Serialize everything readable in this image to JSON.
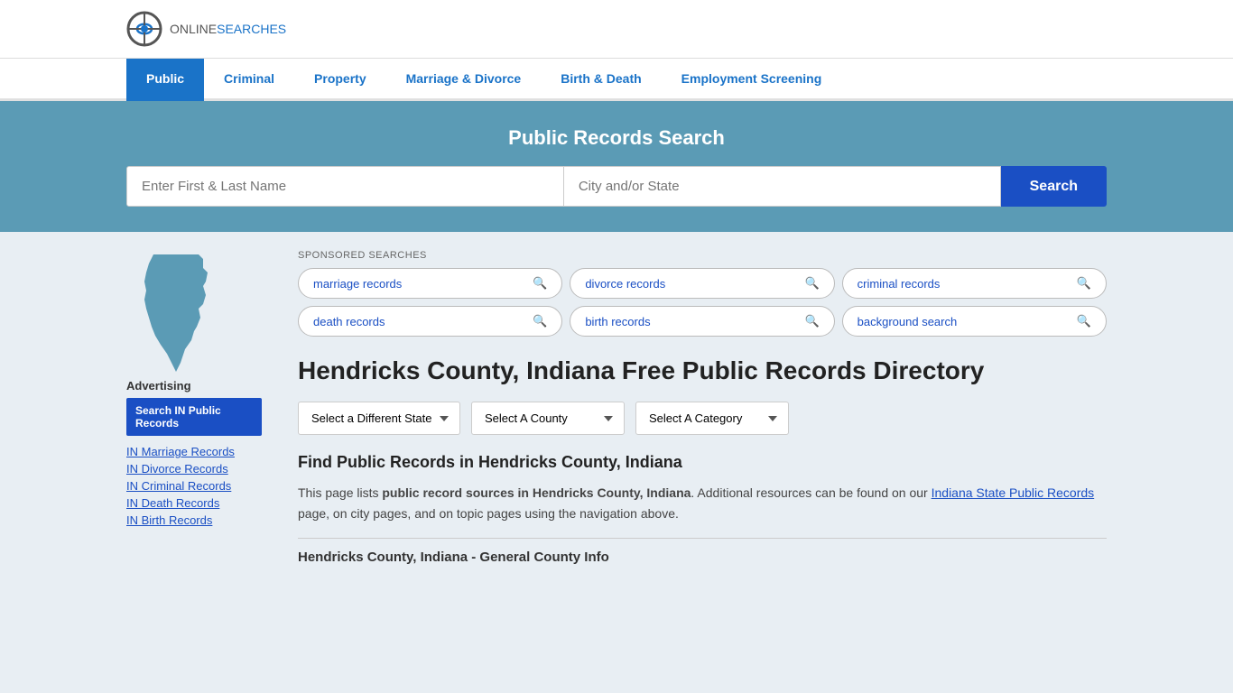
{
  "logo": {
    "online": "ONLINE",
    "searches": "SEARCHES"
  },
  "nav": {
    "items": [
      {
        "label": "Public",
        "active": true
      },
      {
        "label": "Criminal",
        "active": false
      },
      {
        "label": "Property",
        "active": false
      },
      {
        "label": "Marriage & Divorce",
        "active": false
      },
      {
        "label": "Birth & Death",
        "active": false
      },
      {
        "label": "Employment Screening",
        "active": false
      }
    ]
  },
  "hero": {
    "title": "Public Records Search",
    "name_placeholder": "Enter First & Last Name",
    "location_placeholder": "City and/or State",
    "search_button": "Search"
  },
  "sponsored": {
    "label": "SPONSORED SEARCHES",
    "tags": [
      {
        "text": "marriage records"
      },
      {
        "text": "divorce records"
      },
      {
        "text": "criminal records"
      },
      {
        "text": "death records"
      },
      {
        "text": "birth records"
      },
      {
        "text": "background search"
      }
    ]
  },
  "page": {
    "title": "Hendricks County, Indiana Free Public Records Directory",
    "dropdowns": {
      "state": "Select a Different State",
      "county": "Select A County",
      "category": "Select A Category"
    },
    "find_title": "Find Public Records in Hendricks County, Indiana",
    "find_text_1": "This page lists ",
    "find_bold": "public record sources in Hendricks County, Indiana",
    "find_text_2": ". Additional resources can be found on our ",
    "find_link": "Indiana State Public Records",
    "find_text_3": " page, on city pages, and on topic pages using the navigation above.",
    "county_info_title": "Hendricks County, Indiana - General County Info"
  },
  "sidebar": {
    "advertising_label": "Advertising",
    "ad_button": "Search IN Public Records",
    "links": [
      {
        "label": "IN Marriage Records"
      },
      {
        "label": "IN Divorce Records"
      },
      {
        "label": "IN Criminal Records"
      },
      {
        "label": "IN Death Records"
      },
      {
        "label": "IN Birth Records"
      }
    ]
  }
}
